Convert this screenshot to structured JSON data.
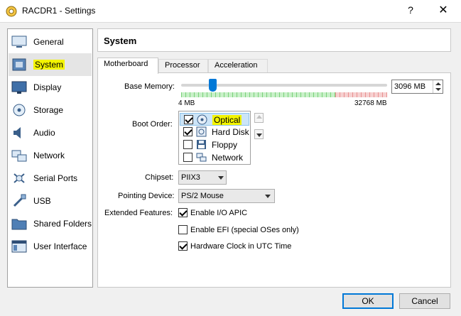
{
  "window": {
    "title": "RACDR1 - Settings",
    "help_glyph": "?",
    "close_glyph": "✕"
  },
  "sidebar": {
    "items": [
      {
        "label": "General",
        "icon": "general-icon"
      },
      {
        "label": "System",
        "icon": "system-icon",
        "selected": true,
        "highlight": "#f3f400"
      },
      {
        "label": "Display",
        "icon": "display-icon"
      },
      {
        "label": "Storage",
        "icon": "storage-icon"
      },
      {
        "label": "Audio",
        "icon": "audio-icon"
      },
      {
        "label": "Network",
        "icon": "network-icon"
      },
      {
        "label": "Serial Ports",
        "icon": "serial-ports-icon"
      },
      {
        "label": "USB",
        "icon": "usb-icon"
      },
      {
        "label": "Shared Folders",
        "icon": "shared-folders-icon"
      },
      {
        "label": "User Interface",
        "icon": "user-interface-icon"
      }
    ]
  },
  "header": {
    "title": "System"
  },
  "tabs": [
    {
      "label": "Motherboard",
      "active": true
    },
    {
      "label": "Processor"
    },
    {
      "label": "Acceleration"
    }
  ],
  "motherboard": {
    "base_memory": {
      "label": "Base Memory:",
      "value_text": "3096 MB",
      "value_mb": 3096,
      "min_label": "4 MB",
      "max_label": "32768 MB",
      "min_mb": 4,
      "max_mb": 32768
    },
    "boot_order": {
      "label": "Boot Order:",
      "items": [
        {
          "label": "Optical",
          "checked": true,
          "icon": "optical-disc-icon",
          "selected": true
        },
        {
          "label": "Hard Disk",
          "checked": true,
          "icon": "hard-disk-icon"
        },
        {
          "label": "Floppy",
          "checked": false,
          "icon": "floppy-icon"
        },
        {
          "label": "Network",
          "checked": false,
          "icon": "network-boot-icon"
        }
      ]
    },
    "chipset": {
      "label": "Chipset:",
      "value": "PIIX3"
    },
    "pointing_device": {
      "label": "Pointing Device:",
      "value": "PS/2 Mouse"
    },
    "extended_features": {
      "label": "Extended Features:",
      "options": [
        {
          "label": "Enable I/O APIC",
          "checked": true
        },
        {
          "label": "Enable EFI (special OSes only)",
          "checked": false
        },
        {
          "label": "Hardware Clock in UTC Time",
          "checked": true
        }
      ]
    }
  },
  "buttons": {
    "ok": "OK",
    "cancel": "Cancel"
  },
  "colors": {
    "accent": "#0078d7",
    "highlight": "#f3f400",
    "selection": "#cce4f7"
  }
}
